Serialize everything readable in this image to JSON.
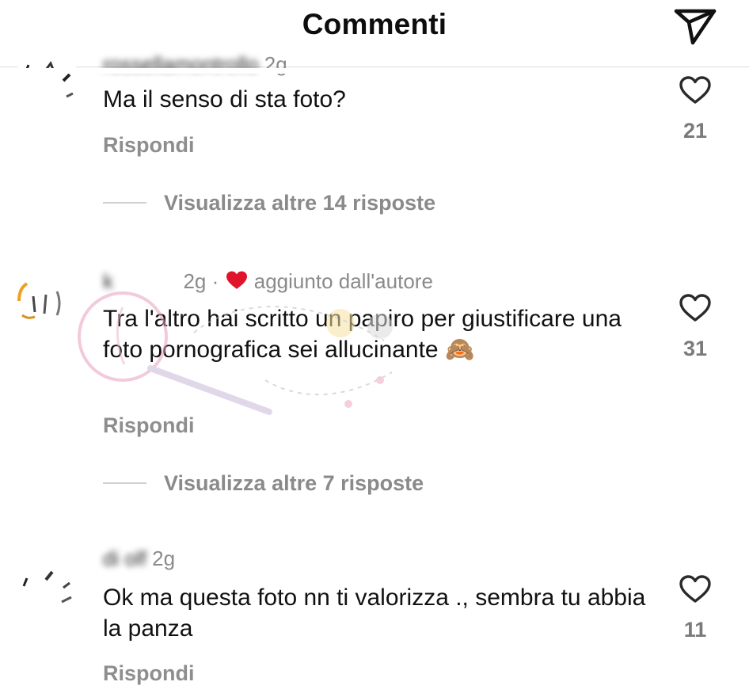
{
  "header": {
    "title": "Commenti",
    "share_icon": "send-icon"
  },
  "comments": [
    {
      "username": "rossellamontrollo",
      "time": "2g",
      "text": "Ma il senso di sta foto?",
      "reply_label": "Rispondi",
      "likes": "21",
      "more_replies": "Visualizza altre 14 risposte"
    },
    {
      "username": "k",
      "time": "2g",
      "separator": "·",
      "author_note": "aggiunto dall'autore",
      "text": "Tra l'altro hai scritto un papiro per giustificare una foto pornografica sei allucinante 🙈",
      "reply_label": "Rispondi",
      "likes": "31",
      "more_replies": "Visualizza altre 7 risposte"
    },
    {
      "username": "di        olf",
      "time": "2g",
      "text": "Ok ma questa foto nn ti valorizza ., sembra tu abbia la panza",
      "reply_label": "Rispondi",
      "likes": "11"
    }
  ]
}
